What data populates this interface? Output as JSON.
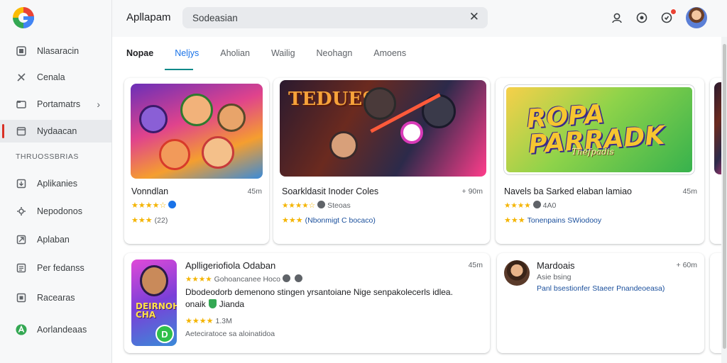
{
  "app": {
    "title": "Apllapam"
  },
  "search": {
    "value": "Sodeasian"
  },
  "sidebar": {
    "items": [
      {
        "label": "Nlasaracin",
        "icon": "dashboard-icon"
      },
      {
        "label": "Cenala",
        "icon": "puzzle-icon"
      },
      {
        "label": "Portamatrs",
        "icon": "folder-icon"
      },
      {
        "label": "Nydaacan",
        "icon": "calendar-icon"
      }
    ],
    "section_label": "THRUOSSBRIAS",
    "section_items": [
      {
        "label": "Aplikanies",
        "icon": "download-icon"
      },
      {
        "label": "Nepodonos",
        "icon": "gear-icon"
      },
      {
        "label": "Aplaban",
        "icon": "share-icon"
      },
      {
        "label": "Per fedanss",
        "icon": "list-icon"
      },
      {
        "label": "Racearas",
        "icon": "box-icon"
      },
      {
        "label": "Aorlandeaas",
        "icon": "android-icon"
      }
    ]
  },
  "tabs": [
    "Nopae",
    "Neljys",
    "Aholian",
    "Wailig",
    "Neohagn",
    "Amoens"
  ],
  "colors": {
    "accent": "#0b8a8a",
    "star": "#f4b400",
    "link": "#1a4f9c",
    "active_marker": "#d93025"
  },
  "cards": [
    {
      "title": "Vonndlan",
      "size": "45m",
      "meta1": "★★★★☆",
      "stars2": "★★★",
      "meta2": "(22)"
    },
    {
      "title": "Soarkldasit Inoder Coles",
      "size": "+ 90m",
      "art_title": "TEDUES",
      "meta1": "Steoas",
      "meta2_stars": "★★★",
      "meta2": "(Nbonmigt C bocaco)"
    },
    {
      "title": "Navels ba Sarked elaban lamiao",
      "size": "45m",
      "art_title": "ROPA PARRADK",
      "art_sub": "Thefpadis",
      "meta1": "4A0",
      "meta2_stars": "★★★",
      "meta2": "Tonenpains SWiodooy"
    },
    {
      "title": "Aplligeriofiola Odaban",
      "size": "45m",
      "meta1": "Gohoancanee Hoco",
      "desc1": "Dbodeodorb demenono stingen yrsantoiane Nige senpakolecerls idlea.",
      "desc2_pre": "onaik",
      "desc2_post": "Jianda",
      "meta2": "1.3M",
      "meta3": "Aeteciratoce sa aloinatidoa",
      "icon_text": "DEIRNOH CHA"
    },
    {
      "title": "Mardoais",
      "size": "+ 60m",
      "meta1": "Asie bsing",
      "meta2": "Panl bsestionfer Staeer Pnandeoeasa)"
    }
  ]
}
